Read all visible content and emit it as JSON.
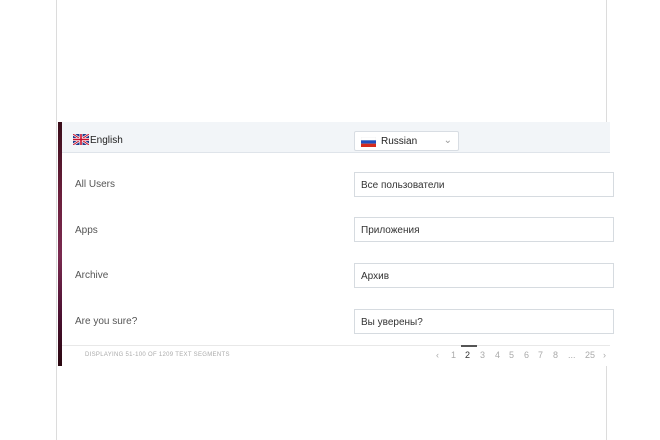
{
  "header": {
    "source_language": "English",
    "target_language": "Russian"
  },
  "rows": [
    {
      "source": "All Users",
      "target": "Все пользователи"
    },
    {
      "source": "Apps",
      "target": "Приложения"
    },
    {
      "source": "Archive",
      "target": "Архив"
    },
    {
      "source": "Are you sure?",
      "target": "Вы уверены?"
    }
  ],
  "footer": {
    "summary": "DISPLAYING 51-100 OF 1209 TEXT SEGMENTS"
  },
  "pagination": {
    "prev": "‹",
    "pages": [
      "1",
      "2",
      "3",
      "4",
      "5",
      "6",
      "7",
      "8",
      "...",
      "25"
    ],
    "next": "›",
    "current": "2"
  },
  "icons": {
    "source_flag": "uk-flag-icon",
    "target_flag": "russia-flag-icon",
    "dropdown": "chevron-down-icon"
  }
}
